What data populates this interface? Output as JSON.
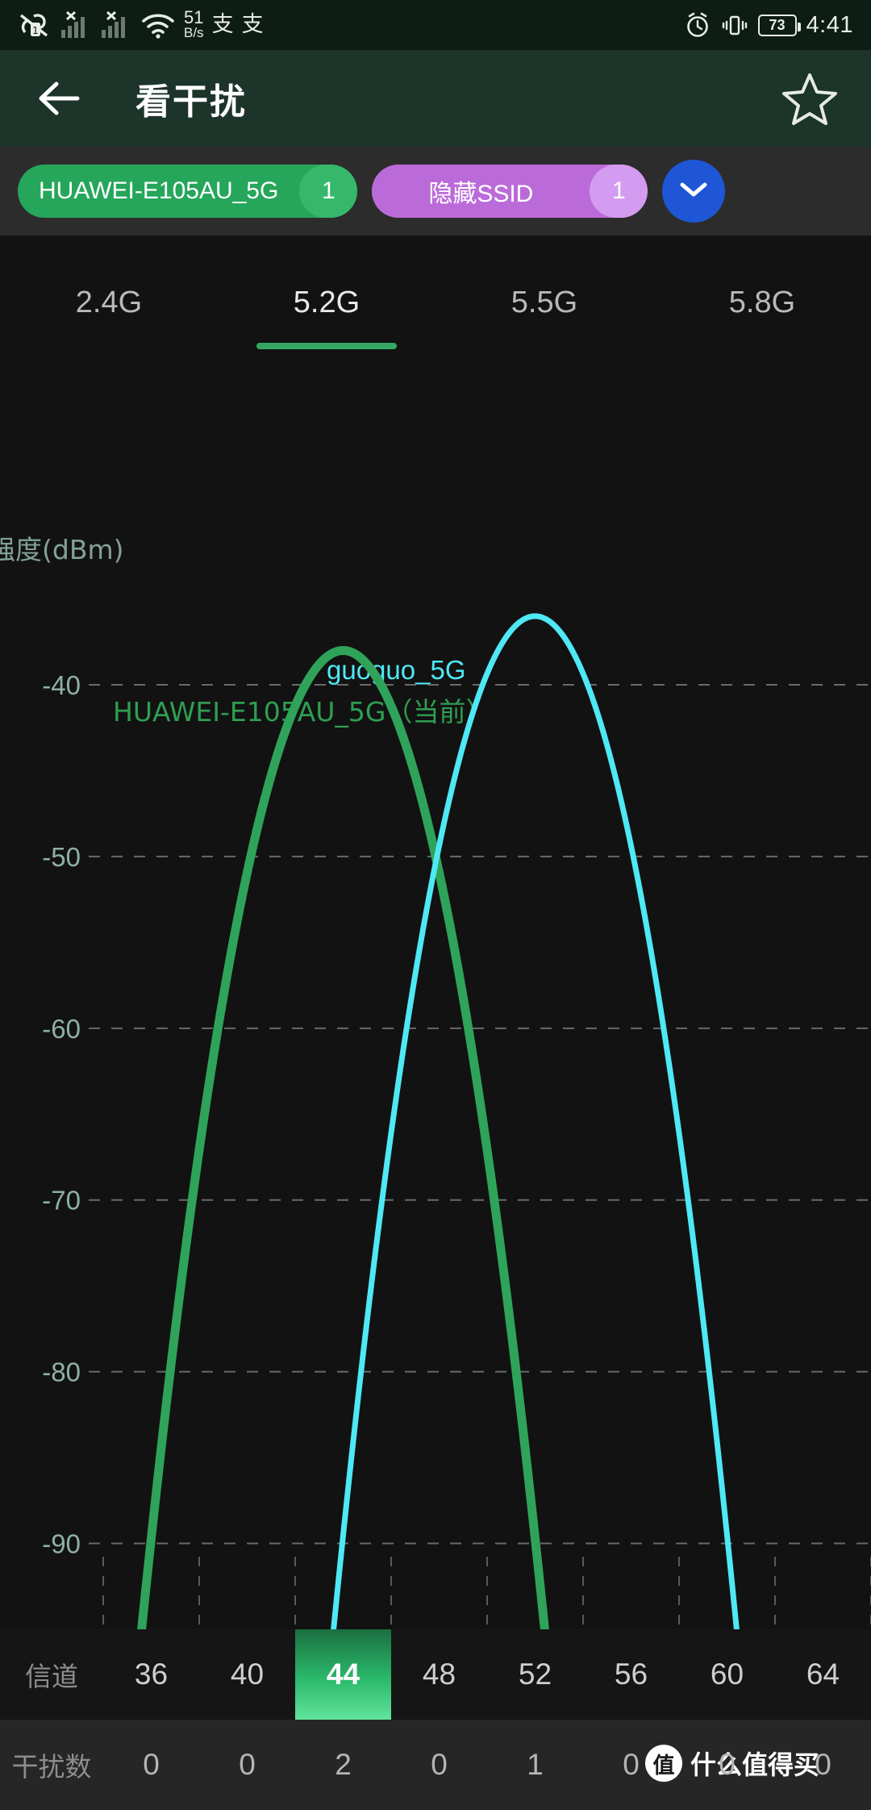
{
  "statusbar": {
    "netspeed_value": "51",
    "netspeed_unit": "B/s",
    "ime_1": "支",
    "ime_2": "支",
    "battery": "73",
    "clock": "4:41",
    "icons": [
      "nfc-off-icon",
      "sim1-icon",
      "signal-no-service-1-icon",
      "signal-no-service-2-icon",
      "wifi-icon",
      "alarm-icon",
      "vibrate-icon",
      "battery-icon"
    ]
  },
  "appbar": {
    "back_icon": "back-arrow-icon",
    "title": "看干扰",
    "star_icon": "star-outline-icon"
  },
  "pillbar": {
    "pills": [
      {
        "label": "HUAWEI-E105AU_5G",
        "count": "1",
        "color": "#26a65b",
        "badge_color": "#35b86c"
      },
      {
        "label": "隐藏SSID",
        "count": "1",
        "color": "#bb6bd9",
        "badge_color": "#d49cf0"
      }
    ],
    "expand_icon": "chevron-down-icon",
    "expand_color": "#1f56d6"
  },
  "tabs": {
    "items": [
      {
        "label": "2.4G",
        "active": false
      },
      {
        "label": "5.2G",
        "active": true
      },
      {
        "label": "5.5G",
        "active": false
      },
      {
        "label": "5.8G",
        "active": false
      }
    ],
    "accent": "#35a765"
  },
  "chart_data": {
    "type": "line",
    "title": "",
    "ylabel": "强度(dBm)",
    "xlabel": "信道",
    "ylim": [
      -95,
      -33
    ],
    "yticks": [
      -40,
      -50,
      -60,
      -70,
      -80,
      -90
    ],
    "ytick_labels": [
      "-40",
      "-50",
      "-60",
      "-70",
      "-80",
      "-90"
    ],
    "categories": [
      "36",
      "40",
      "44",
      "48",
      "52",
      "56",
      "60",
      "64"
    ],
    "grid": true,
    "legend_position": "inline-above-peaks",
    "series": [
      {
        "name": "HUAWEI-E105AU_5G（当前）",
        "color": "#2fa35a",
        "center_channel": "44",
        "peak_dbm": -38,
        "width_channels": 4.2,
        "current": true,
        "label_text": "HUAWEI-E105AU_5G（当前）"
      },
      {
        "name": "guoguo_5G",
        "color": "#4fe8f5",
        "center_channel": "52",
        "peak_dbm": -36,
        "width_channels": 4.2,
        "current": false,
        "label_text": "guoguo_5G"
      }
    ],
    "channel_row_label": "信道",
    "interference_row_label": "干扰数",
    "interference_values": [
      "0",
      "0",
      "2",
      "0",
      "1",
      "0",
      "0",
      "0"
    ],
    "selected_channel": "44",
    "selected_color": "#2bb96b"
  },
  "watermark": {
    "badge": "值",
    "text": "什么值得买"
  }
}
